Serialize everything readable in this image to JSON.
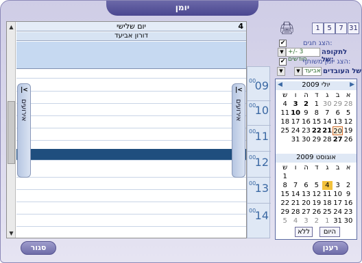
{
  "window": {
    "title": "יומן"
  },
  "dayview": {
    "day_number": "4",
    "day_name": "יום שלישי",
    "person": "דורון אביעד",
    "side_label": "אירועים",
    "side_button": "|<"
  },
  "times": [
    {
      "hour": "09",
      "min": "00"
    },
    {
      "hour": "10",
      "min": "00"
    },
    {
      "hour": "11",
      "min": "00"
    },
    {
      "hour": "12",
      "min": "00"
    },
    {
      "hour": "13",
      "min": "00"
    },
    {
      "hour": "14",
      "min": "00"
    }
  ],
  "toolbar": {
    "view_buttons": [
      "31",
      "7",
      "5",
      "1"
    ]
  },
  "options": {
    "show_holidays": "הצג חגים:",
    "period_label": "לתקופה של:",
    "period_value": "+/- 3 חודשים",
    "show_shared": "הצג יומן משותף:",
    "employees_label": "של העובדים",
    "employee_value": "דורון אביעד"
  },
  "calendar": {
    "weekday_headers": [
      "א",
      "ב",
      "ג",
      "ד",
      "ה",
      "ו",
      "ש"
    ],
    "months": [
      {
        "title": "יולי 2009",
        "weeks": [
          [
            "28",
            "29",
            "30",
            "1",
            "2",
            "3",
            "4"
          ],
          [
            "5",
            "6",
            "7",
            "8",
            "9",
            "10",
            "11"
          ],
          [
            "12",
            "13",
            "14",
            "15",
            "16",
            "17",
            "18"
          ],
          [
            "19",
            "20",
            "21",
            "22",
            "23",
            "24",
            "25"
          ],
          [
            "26",
            "27",
            "28",
            "29",
            "30",
            "31",
            ""
          ]
        ]
      },
      {
        "title": "אוגוסט 2009",
        "weeks": [
          [
            "",
            "",
            "",
            "",
            "",
            "",
            "1"
          ],
          [
            "2",
            "3",
            "4",
            "5",
            "6",
            "7",
            "8"
          ],
          [
            "9",
            "10",
            "11",
            "12",
            "13",
            "14",
            "15"
          ],
          [
            "16",
            "17",
            "18",
            "19",
            "20",
            "21",
            "22"
          ],
          [
            "23",
            "24",
            "25",
            "26",
            "27",
            "28",
            "29"
          ],
          [
            "30",
            "31",
            "1",
            "2",
            "3",
            "4",
            "5"
          ]
        ]
      }
    ],
    "today_button": "היום",
    "none_button": "ללא"
  },
  "buttons": {
    "refresh": "רענן",
    "close": "סגור"
  }
}
